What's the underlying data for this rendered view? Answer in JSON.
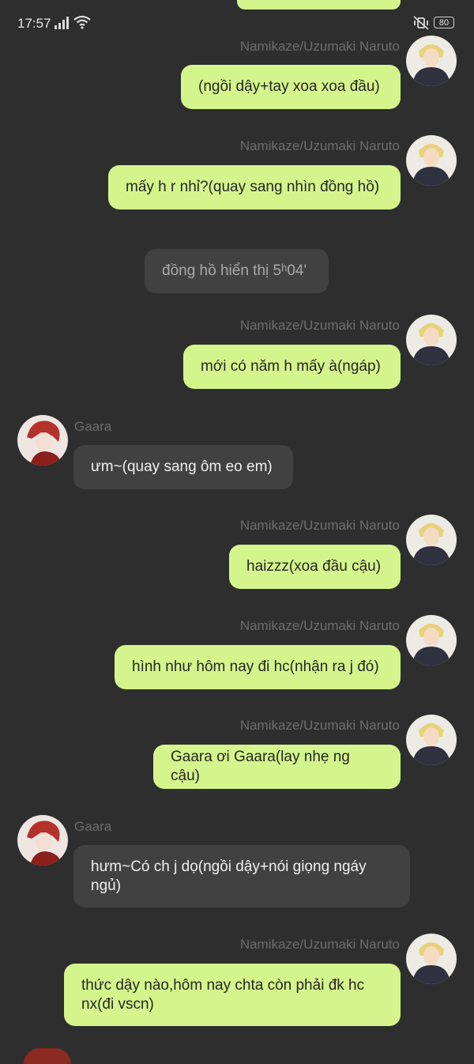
{
  "status": {
    "time": "17:57",
    "battery": "80",
    "icons": [
      "signal-icon",
      "wifi-icon",
      "mute-vibrate-icon",
      "battery-icon"
    ]
  },
  "colors": {
    "background": "#2e2e2e",
    "my_bubble": "#d4f58c",
    "other_bubble": "#414141",
    "name_text": "#6d6d6d"
  },
  "messages": [
    {
      "sender": "Namikaze/Uzumaki Naruto",
      "text": "(ngồi dậy+tay xoa xoa đầu)"
    },
    {
      "sender": "Namikaze/Uzumaki Naruto",
      "text": "mấy h r nhỉ?(quay sang nhìn đồng hồ)"
    },
    {
      "sender": "",
      "text": "đồng hồ hiển thị 5ʰ04'"
    },
    {
      "sender": "Namikaze/Uzumaki Naruto",
      "text": "mới có năm h mấy à(ngáp)"
    },
    {
      "sender": "Gaara",
      "text": "ưm~(quay sang ôm eo em)"
    },
    {
      "sender": "Namikaze/Uzumaki Naruto",
      "text": "haizzz(xoa đầu cậu)"
    },
    {
      "sender": "Namikaze/Uzumaki Naruto",
      "text": "hình như hôm nay đi hc(nhận ra j đó)"
    },
    {
      "sender": "Namikaze/Uzumaki Naruto",
      "text": "Gaara ơi Gaara(lay nhẹ ng cậu)"
    },
    {
      "sender": "Gaara",
      "text": "hưm~Có ch j dọ(ngồi dậy+nói giọng ngáy ngủ)"
    },
    {
      "sender": "Namikaze/Uzumaki Naruto",
      "text": "thức dậy nào,hôm nay chta còn phải đk hc nx(đi vscn)"
    }
  ]
}
